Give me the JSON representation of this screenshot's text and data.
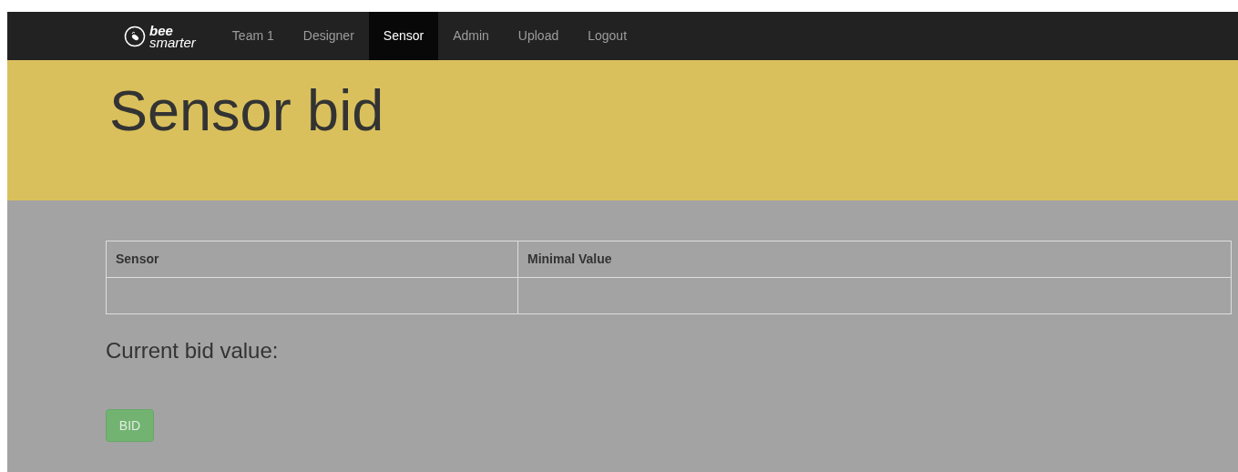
{
  "navbar": {
    "logo": {
      "line_1": "bee",
      "line_2": "smarter"
    },
    "items": [
      {
        "label": "Team 1",
        "selected": false
      },
      {
        "label": "Designer",
        "selected": false
      },
      {
        "label": "Sensor",
        "selected": true
      },
      {
        "label": "Admin",
        "selected": false
      },
      {
        "label": "Upload",
        "selected": false
      },
      {
        "label": "Logout",
        "selected": false
      }
    ]
  },
  "header": {
    "title": "Sensor bid"
  },
  "table": {
    "columns": [
      "Sensor",
      "Minimal Value"
    ]
  },
  "current_bid": {
    "label": "Current bid value:"
  },
  "bid_button": {
    "label": "BID",
    "disabled": true
  }
}
